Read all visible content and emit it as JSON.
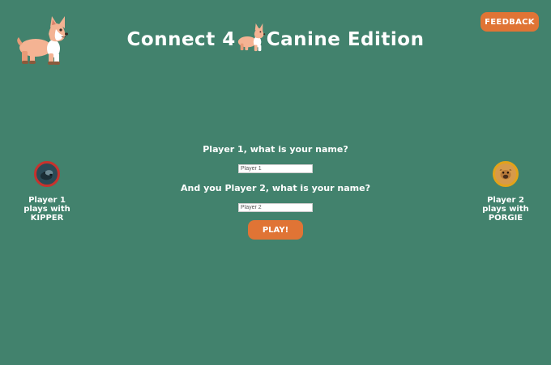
{
  "header": {
    "title_left": "Connect 4",
    "title_right": "Canine Edition",
    "feedback_label": "FEEDBACK",
    "logo_icon": "corgi-dog-icon"
  },
  "form": {
    "player1_question": "Player 1, what is your name?",
    "player1_placeholder": "Player 1",
    "player2_question": "And you Player 2, what is your name?",
    "player2_placeholder": "Player 2",
    "play_label": "PLAY!"
  },
  "players": {
    "p1": {
      "line1": "Player 1",
      "line2": "plays with",
      "dog": "KIPPER",
      "token_color": "#c7322d",
      "avatar_icon": "kipper-dog-avatar-icon"
    },
    "p2": {
      "line1": "Player 2",
      "line2": "plays with",
      "dog": "PORGIE",
      "token_color": "#e2a31a",
      "avatar_icon": "porgie-dog-avatar-icon"
    }
  },
  "colors": {
    "background": "#42826d",
    "accent": "#e07435",
    "text": "#ffffff"
  }
}
